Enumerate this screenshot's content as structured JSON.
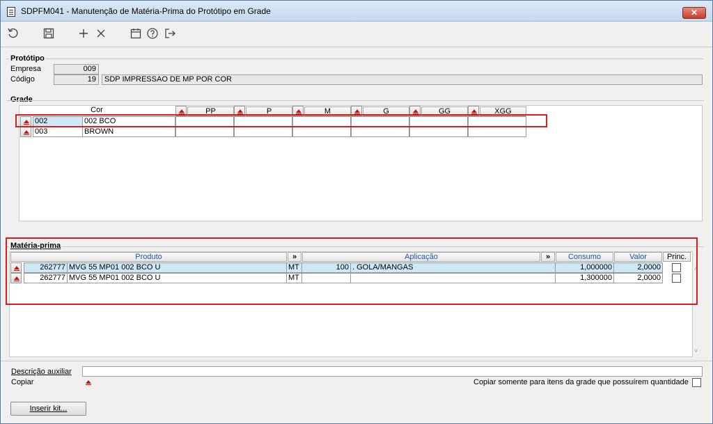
{
  "window": {
    "title": "SDPFM041 - Manutenção de Matéria-Prima do Protótipo em Grade",
    "close_label": "✕"
  },
  "toolbar": {
    "icons": [
      "undo-icon",
      "save-icon",
      "add-icon",
      "delete-icon",
      "calendar-icon",
      "help-icon",
      "exit-icon"
    ]
  },
  "prototipo": {
    "label": "Protótipo",
    "empresa_label": "Empresa",
    "empresa_value": "009",
    "codigo_label": "Código",
    "codigo_value": "19",
    "descricao_value": "SDP IMPRESSAO DE MP POR COR"
  },
  "grade": {
    "label": "Grade",
    "cor_header": "Cor",
    "sizes": [
      "PP",
      "P",
      "M",
      "G",
      "GG",
      "XGG"
    ],
    "rows": [
      {
        "code": "002",
        "name": "002 BCO",
        "selected": true
      },
      {
        "code": "003",
        "name": "BROWN",
        "selected": false
      }
    ]
  },
  "materia_prima": {
    "label": "Matéria-prima",
    "headers": {
      "produto": "Produto",
      "expand1": "»",
      "aplicacao": "Aplicação",
      "expand2": "»",
      "consumo": "Consumo",
      "valor": "Valor",
      "princ": "Princ."
    },
    "rows": [
      {
        "code": "262777",
        "desc": "MVG 55 MP01 002 BCO U",
        "unit": "MT",
        "aplic_code": "100",
        "aplic_desc": ". GOLA/MANGAS",
        "consumo": "1,000000",
        "valor": "2,0000",
        "princ": false,
        "selected": true
      },
      {
        "code": "262777",
        "desc": "MVG 55 MP01 002 BCO U",
        "unit": "MT",
        "aplic_code": "",
        "aplic_desc": "",
        "consumo": "1,300000",
        "valor": "2,0000",
        "princ": false,
        "selected": false
      }
    ]
  },
  "footer": {
    "descricao_label": "Descrição auxiliar",
    "descricao_value": "",
    "copiar_label": "Copiar",
    "copiar_somente_label": "Copiar somente para itens da grade que possuírem quantidade",
    "inserir_kit_label": "Inserir kit..."
  }
}
